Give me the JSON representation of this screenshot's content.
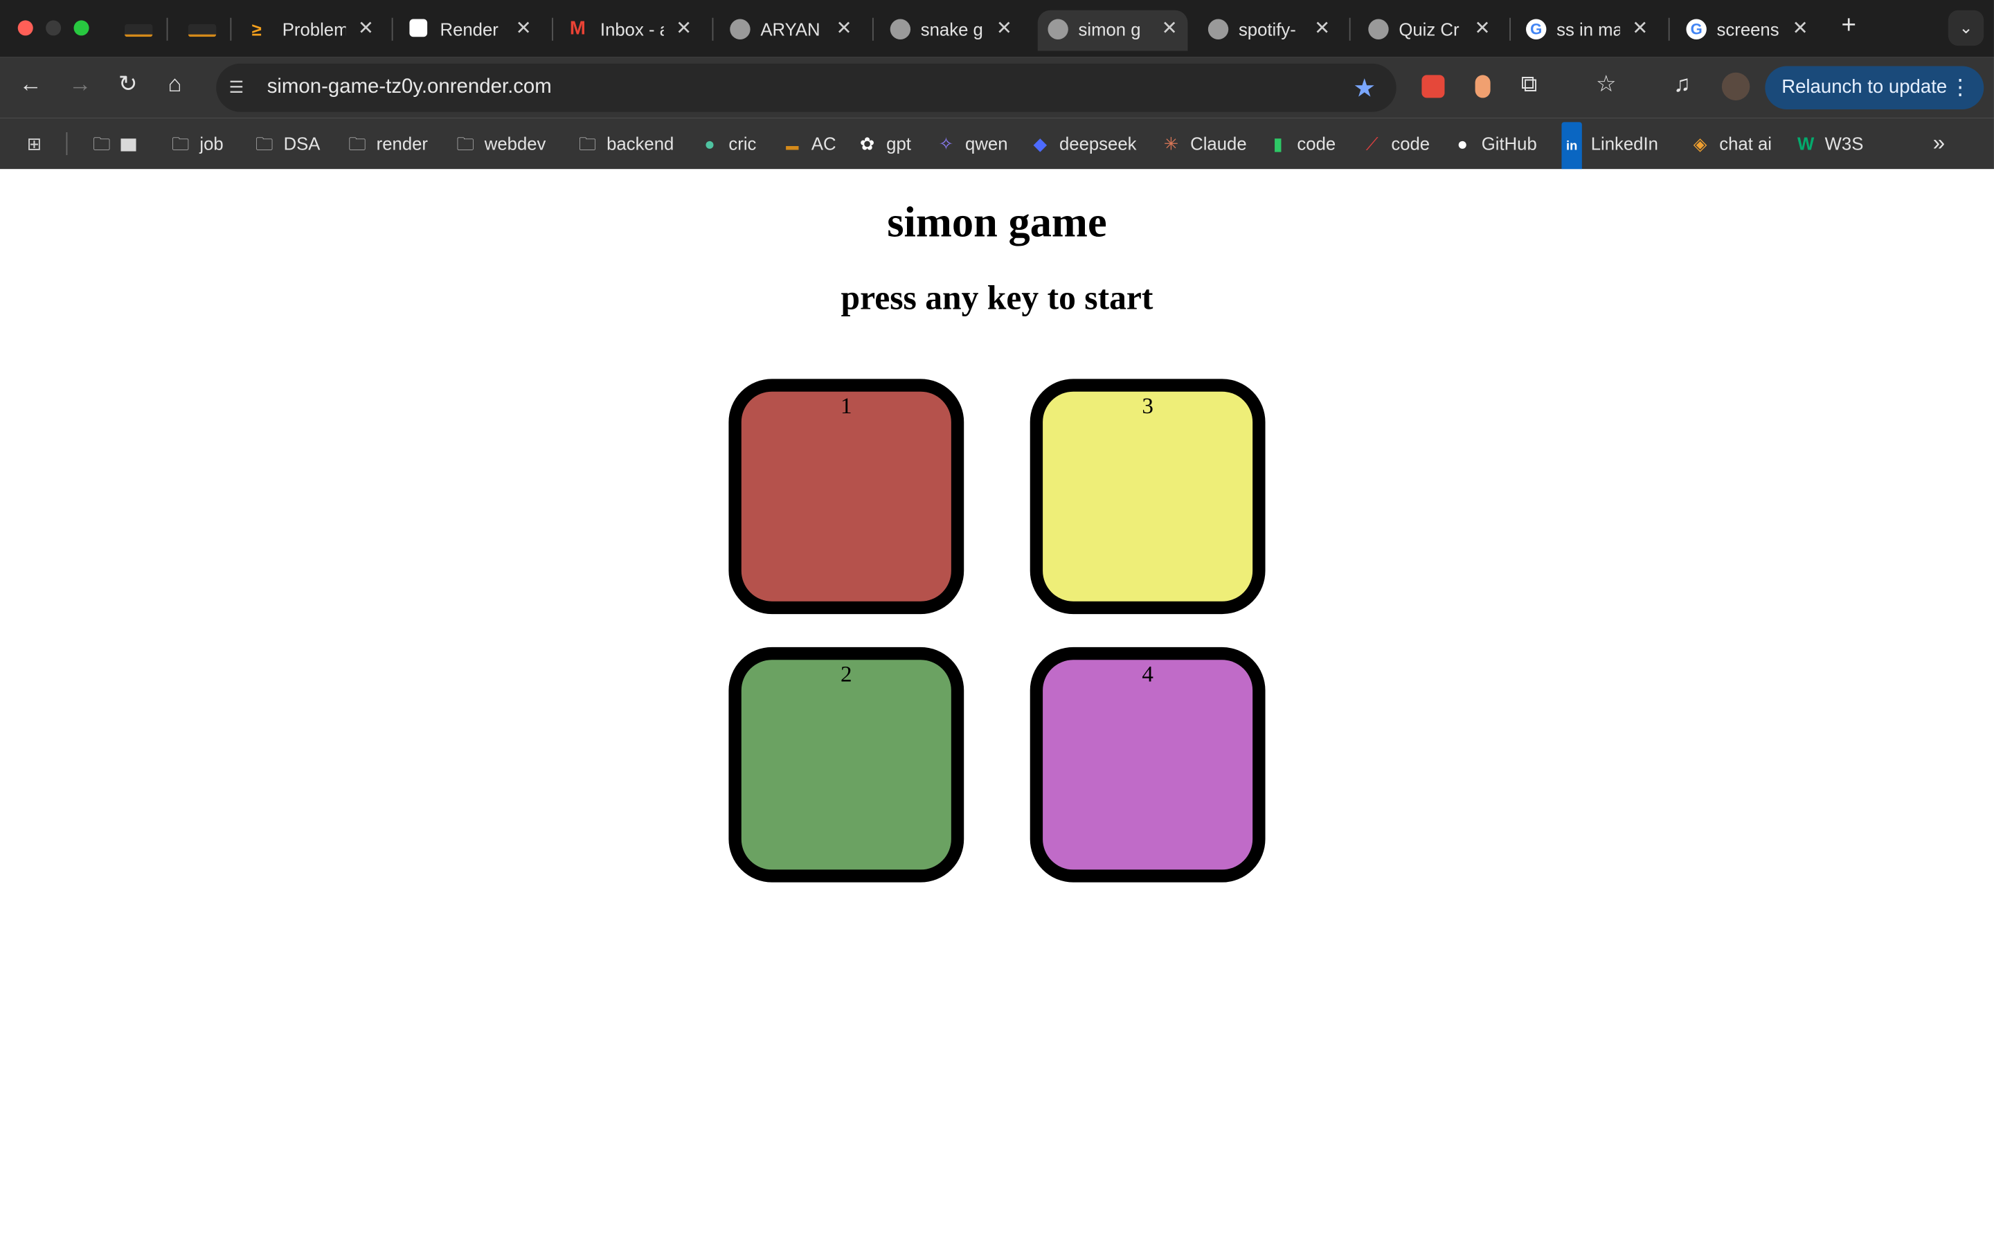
{
  "browser": {
    "tabs": [
      {
        "title": "",
        "icon": "course-logo-icon",
        "active": false
      },
      {
        "title": "",
        "icon": "course-logo-icon",
        "active": false
      },
      {
        "title": "Problem",
        "icon": "leetcode-icon",
        "active": false
      },
      {
        "title": "Render",
        "icon": "render-icon",
        "active": false
      },
      {
        "title": "Inbox - a",
        "icon": "gmail-icon",
        "active": false
      },
      {
        "title": "ARYAN",
        "icon": "globe-icon",
        "active": false
      },
      {
        "title": "snake g",
        "icon": "globe-icon",
        "active": false
      },
      {
        "title": "simon g",
        "icon": "globe-icon",
        "active": true
      },
      {
        "title": "spotify-",
        "icon": "globe-icon",
        "active": false
      },
      {
        "title": "Quiz Cr",
        "icon": "globe-icon",
        "active": false
      },
      {
        "title": "ss in ma",
        "icon": "google-icon",
        "active": false
      },
      {
        "title": "screens",
        "icon": "google-icon",
        "active": false
      }
    ],
    "url": "simon-game-tz0y.onrender.com",
    "relaunch_label": "Relaunch to update",
    "bookmarks": [
      {
        "label": "",
        "icon": "folder-icon"
      },
      {
        "label": "job",
        "icon": "folder-icon"
      },
      {
        "label": "DSA",
        "icon": "folder-icon"
      },
      {
        "label": "render",
        "icon": "folder-icon"
      },
      {
        "label": "webdev",
        "icon": "folder-icon"
      },
      {
        "label": "backend",
        "icon": "folder-icon"
      },
      {
        "label": "cric",
        "icon": "cric-icon"
      },
      {
        "label": "AC",
        "icon": "course-logo-icon"
      },
      {
        "label": "gpt",
        "icon": "openai-icon"
      },
      {
        "label": "qwen",
        "icon": "qwen-icon"
      },
      {
        "label": "deepseek",
        "icon": "deepseek-icon"
      },
      {
        "label": "Claude",
        "icon": "claude-icon"
      },
      {
        "label": "code",
        "icon": "code-icon"
      },
      {
        "label": "code",
        "icon": "code-icon"
      },
      {
        "label": "GitHub",
        "icon": "github-icon"
      },
      {
        "label": "LinkedIn",
        "icon": "linkedin-icon"
      },
      {
        "label": "chat ai",
        "icon": "chat-ai-icon"
      },
      {
        "label": "W3S",
        "icon": "w3s-icon"
      }
    ]
  },
  "page": {
    "title": "simon game",
    "subtitle": "press any key to start",
    "buttons": [
      {
        "label": "1",
        "color": "#b5524c"
      },
      {
        "label": "3",
        "color": "#eeee78"
      },
      {
        "label": "2",
        "color": "#6ba262"
      },
      {
        "label": "4",
        "color": "#c06bc8"
      }
    ]
  }
}
